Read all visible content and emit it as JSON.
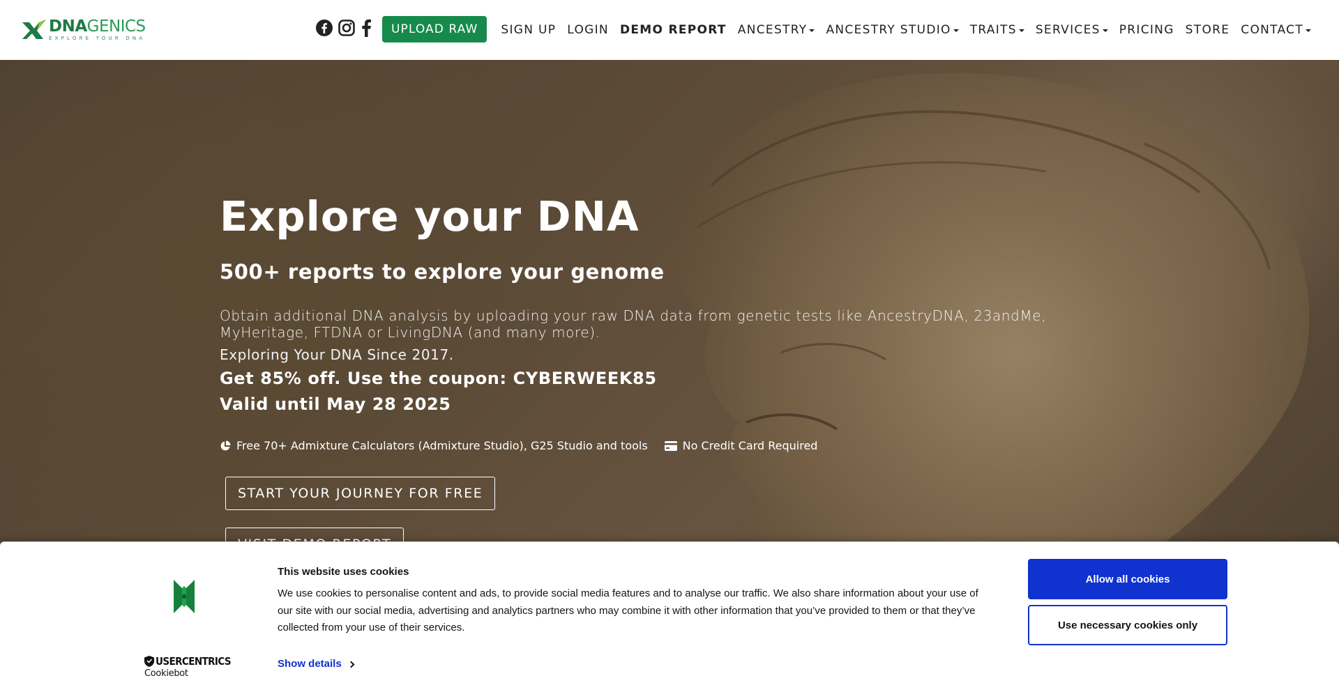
{
  "colors": {
    "brand_green": "#158a4b",
    "cookie_blue": "#1032cf",
    "text_dark": "#141414"
  },
  "logo": {
    "name_dna": "DNA",
    "name_genics": "GENICS",
    "tagline": "EXPLORE YOUR DNA"
  },
  "nav": {
    "social_icons": [
      "facebook-circle-icon",
      "instagram-icon",
      "facebook-f-icon"
    ],
    "upload": "UPLOAD RAW",
    "signup": "SIGN UP",
    "login": "LOGIN",
    "demo": "DEMO REPORT",
    "ancestry": "ANCESTRY",
    "ancestry_studio": "ANCESTRY STUDIO",
    "traits": "TRAITS",
    "services": "SERVICES",
    "pricing": "PRICING",
    "store": "STORE",
    "contact": "CONTACT"
  },
  "hero": {
    "title": "Explore your DNA",
    "subtitle": "500+ reports to explore your genome",
    "description": "Obtain additional DNA analysis by uploading your raw DNA data from genetic tests like AncestryDNA, 23andMe, MyHeritage, FTDNA or LivingDNA (and many more).",
    "since": "Exploring Your DNA Since 2017.",
    "promo": "Get 85% off. Use the coupon: CYBERWEEK85",
    "valid": "Valid until May 28 2025",
    "feature1": "Free 70+ Admixture Calculators (Admixture Studio), G25 Studio and tools",
    "feature2": "No Credit Card Required",
    "cta_primary": "START YOUR JOURNEY FOR FREE",
    "cta_secondary": "VISIT DEMO REPORT"
  },
  "cookie": {
    "title": "This website uses cookies",
    "text": "We use cookies to personalise content and ads, to provide social media features and to analyse our traffic. We also share information about your use of our site with our social media, advertising and analytics partners who may combine it with other information that you’ve provided to them or that they’ve collected from your use of their services.",
    "show_details": "Show details",
    "allow_all": "Allow all cookies",
    "necessary_only": "Use necessary cookies only",
    "brand": "USERCENTRICS",
    "brand_sub": "Cookiebot"
  }
}
